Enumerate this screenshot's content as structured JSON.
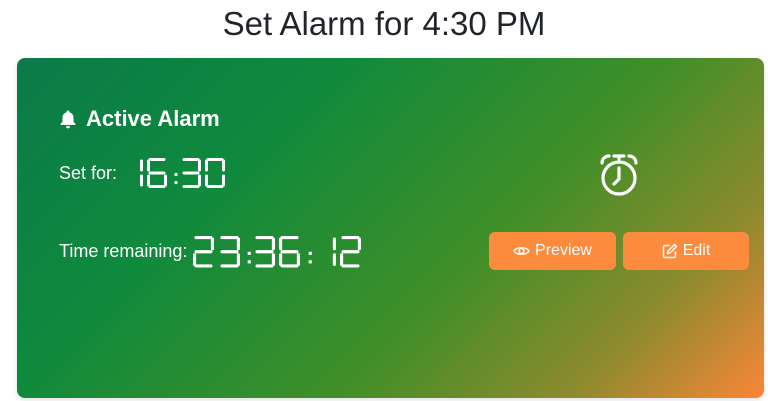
{
  "page": {
    "title": "Set Alarm for 4:30 PM"
  },
  "card": {
    "header": "Active Alarm",
    "header_icon": "bell-icon",
    "set_for_label": "Set for:",
    "set_for_time": "16:30",
    "remaining_label": "Time remaining:",
    "remaining_time": "23:36:12",
    "clock_icon": "alarm-clock-icon",
    "gradient_start": "#0a7a4a",
    "gradient_end": "#fb8638"
  },
  "actions": {
    "preview_label": "Preview",
    "preview_icon": "eye-icon",
    "edit_label": "Edit",
    "edit_icon": "edit-icon",
    "button_color": "#fd8b3d"
  }
}
